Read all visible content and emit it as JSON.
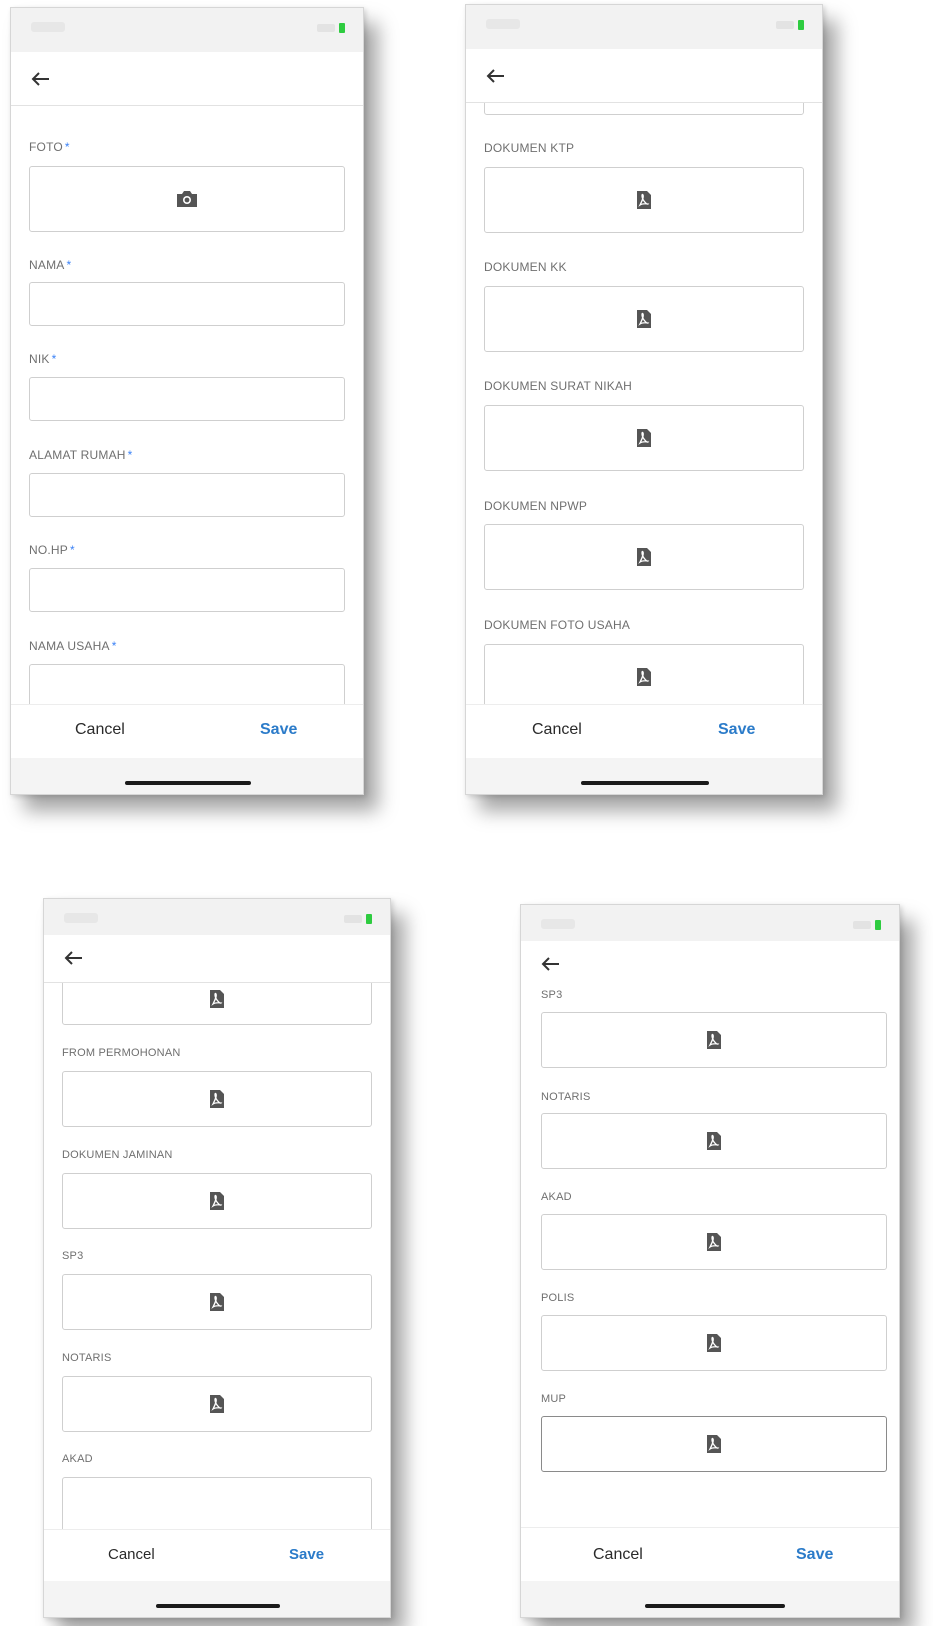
{
  "colors": {
    "accent": "#2b7bc9",
    "required": "#3b82f6",
    "battery": "#2ecc40"
  },
  "icons": {
    "back": "arrow-left-icon",
    "camera": "camera-icon",
    "pdf": "pdf-file-icon"
  },
  "screens": [
    {
      "fields": [
        {
          "label": "FOTO",
          "required": "*",
          "icon": "camera"
        },
        {
          "label": "NAMA",
          "required": "*"
        },
        {
          "label": "NIK",
          "required": "*"
        },
        {
          "label": "ALAMAT RUMAH",
          "required": "*"
        },
        {
          "label": "NO.HP",
          "required": "*"
        },
        {
          "label": "NAMA USAHA",
          "required": "*"
        }
      ],
      "cancel": "Cancel",
      "save": "Save"
    },
    {
      "fields": [
        {
          "label": "DOKUMEN KTP"
        },
        {
          "label": "DOKUMEN KK"
        },
        {
          "label": "DOKUMEN SURAT NIKAH"
        },
        {
          "label": "DOKUMEN NPWP"
        },
        {
          "label": "DOKUMEN FOTO USAHA"
        }
      ],
      "cancel": "Cancel",
      "save": "Save"
    },
    {
      "fields": [
        {
          "label": "FROM PERMOHONAN"
        },
        {
          "label": "DOKUMEN JAMINAN"
        },
        {
          "label": "SP3"
        },
        {
          "label": "NOTARIS"
        },
        {
          "label": "AKAD"
        }
      ],
      "cancel": "Cancel",
      "save": "Save"
    },
    {
      "fields": [
        {
          "label": "SP3"
        },
        {
          "label": "NOTARIS"
        },
        {
          "label": "AKAD"
        },
        {
          "label": "POLIS"
        },
        {
          "label": "MUP"
        }
      ],
      "cancel": "Cancel",
      "save": "Save"
    }
  ]
}
